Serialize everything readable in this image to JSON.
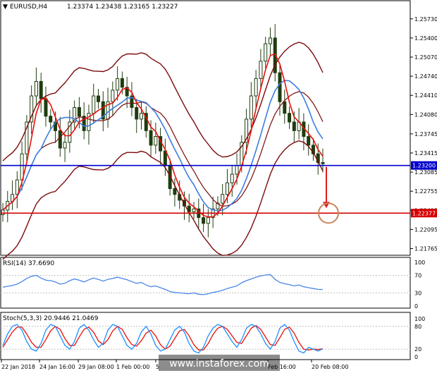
{
  "header": {
    "symbol": "EURUSD,H4",
    "ohlc": "1.23374 1.23438 1.23165 1.23227"
  },
  "watermark": "www.instaforex.com",
  "colors": {
    "candle": "#1f3d0f",
    "bollinger": "#7a0a0a",
    "ma_fast": "#e8100c",
    "ma_slow": "#3c7de0",
    "support": "#0000cc",
    "target": "#d40000",
    "arrow": "#e11b1b",
    "target_circle": "#c8865a",
    "rsi_line": "#4a86e8",
    "stoch_main": "#1e90ff",
    "stoch_signal": "#e8100c",
    "tag_blue": "#0000cc",
    "tag_red": "#d40000"
  },
  "chart_data": [
    {
      "type": "candlestick",
      "panel": "price",
      "y_ticks": [
        "1.25730",
        "1.25400",
        "1.25070",
        "1.24740",
        "1.24410",
        "1.24080",
        "1.23745",
        "1.23415",
        "1.23085",
        "1.22755",
        "1.22425",
        "1.22095",
        "1.21765"
      ],
      "ylim": [
        1.2165,
        1.258
      ],
      "x_ticks": [
        "22 Jan 2018",
        "24 Jan 16:00",
        "29 Jan 08:00",
        "1 Feb 00:00",
        "5",
        "Feb 16:00",
        "20 Feb 08:00"
      ],
      "levels": [
        {
          "name": "support",
          "value": 1.232,
          "label": "1.23200"
        },
        {
          "name": "target",
          "value": 1.22377,
          "label": "1.22377"
        }
      ],
      "close": [
        1.2243,
        1.2258,
        1.227,
        1.2295,
        1.234,
        1.2395,
        1.244,
        1.2465,
        1.2435,
        1.2405,
        1.2395,
        1.238,
        1.235,
        1.236,
        1.2395,
        1.242,
        1.2405,
        1.238,
        1.241,
        1.244,
        1.243,
        1.24,
        1.243,
        1.245,
        1.247,
        1.2455,
        1.244,
        1.242,
        1.24,
        1.241,
        1.238,
        1.2355,
        1.237,
        1.2345,
        1.232,
        1.228,
        1.227,
        1.226,
        1.225,
        1.224,
        1.2245,
        1.223,
        1.222,
        1.223,
        1.2245,
        1.2255,
        1.227,
        1.229,
        1.2305,
        1.232,
        1.236,
        1.24,
        1.244,
        1.247,
        1.25,
        1.253,
        1.254,
        1.248,
        1.243,
        1.241,
        1.2395,
        1.238,
        1.2395,
        1.237,
        1.2355,
        1.234,
        1.2325,
        1.2323
      ]
    },
    {
      "type": "line",
      "panel": "rsi",
      "title": "RSI(14) 37.6690",
      "ylim": [
        0,
        100
      ],
      "y_ticks": [
        "100",
        "70",
        "30",
        "0"
      ],
      "values": [
        43,
        45,
        47,
        50,
        56,
        63,
        68,
        70,
        64,
        59,
        58,
        55,
        50,
        52,
        58,
        62,
        59,
        55,
        60,
        64,
        61,
        57,
        61,
        63,
        66,
        63,
        60,
        56,
        52,
        54,
        48,
        44,
        46,
        42,
        38,
        33,
        31,
        30,
        29,
        28,
        30,
        27,
        26,
        28,
        31,
        33,
        36,
        40,
        43,
        46,
        53,
        58,
        62,
        66,
        69,
        71,
        72,
        61,
        54,
        51,
        49,
        46,
        48,
        44,
        42,
        40,
        38,
        37.669
      ]
    },
    {
      "type": "line",
      "panel": "stochastic",
      "title": "Stoch(5,3,3) 20.9446 21.0469",
      "ylim": [
        0,
        100
      ],
      "y_ticks": [
        "100",
        "80",
        "20",
        "0"
      ],
      "series": [
        {
          "values": [
            30,
            60,
            80,
            85,
            70,
            40,
            20,
            15,
            35,
            70,
            85,
            80,
            55,
            30,
            20,
            40,
            75,
            85,
            70,
            45,
            25,
            35,
            70,
            85,
            80,
            55,
            30,
            20,
            35,
            65,
            80,
            60,
            30,
            15,
            20,
            45,
            70,
            80,
            65,
            35,
            15,
            10,
            25,
            55,
            75,
            85,
            80,
            60,
            40,
            25,
            45,
            75,
            85,
            80,
            60,
            35,
            20,
            40,
            75,
            85,
            70,
            40,
            15,
            10,
            25,
            20,
            15,
            20.9446
          ]
        },
        {
          "values": [
            25,
            45,
            65,
            78,
            78,
            60,
            38,
            25,
            25,
            45,
            68,
            80,
            72,
            48,
            30,
            30,
            52,
            72,
            78,
            65,
            42,
            32,
            45,
            68,
            80,
            72,
            50,
            32,
            28,
            42,
            62,
            70,
            55,
            32,
            20,
            28,
            48,
            68,
            72,
            55,
            32,
            18,
            18,
            35,
            58,
            75,
            80,
            72,
            55,
            38,
            35,
            55,
            75,
            82,
            72,
            52,
            32,
            30,
            50,
            72,
            78,
            62,
            38,
            20,
            18,
            20,
            19,
            21.0469
          ]
        }
      ]
    }
  ]
}
